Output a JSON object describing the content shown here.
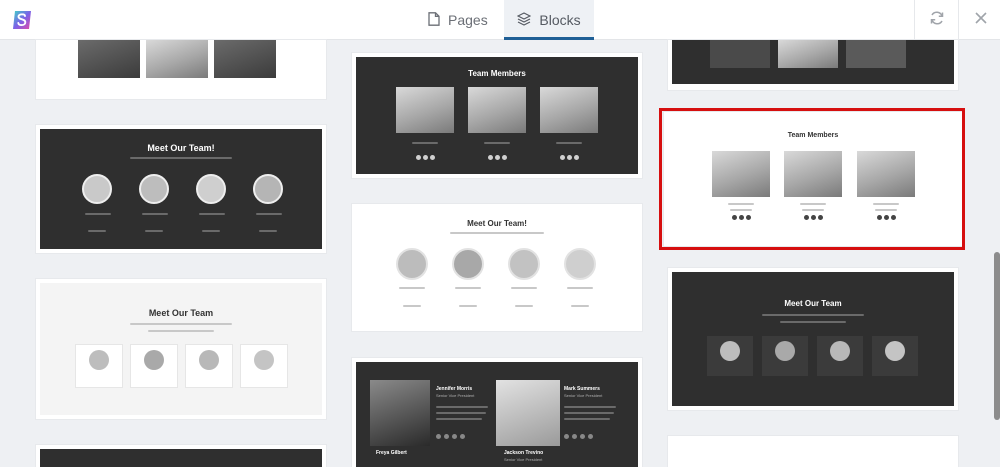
{
  "header": {
    "logo_icon": "brand-logo-icon",
    "tabs": [
      {
        "label": "Pages",
        "icon": "document-icon",
        "active": false
      },
      {
        "label": "Blocks",
        "icon": "layers-icon",
        "active": true
      }
    ],
    "refresh_icon": "refresh-icon",
    "close_icon": "close-icon"
  },
  "colors": {
    "accent": "#1f5f96",
    "selection": "#d60f0f",
    "dark_block": "#2f2f2f",
    "background": "#eef0f3"
  },
  "blocks": {
    "col1_block2": {
      "title": "Meet Our Team!"
    },
    "col1_block3": {
      "title": "Meet Our Team"
    },
    "col2_block1": {
      "title": "Team Members"
    },
    "col2_block2": {
      "title": "Meet Our Team!"
    },
    "col2_block3": {
      "members": [
        {
          "name": "Jennifer Morris",
          "role": "Senior Vice President"
        },
        {
          "name": "Mark Summers",
          "role": "Senior Vice President"
        },
        {
          "name": "Freya Gilbert",
          "role": ""
        },
        {
          "name": "Jackson Trevino",
          "role": "Senior Vice President"
        }
      ]
    },
    "col3_block2": {
      "title": "Team Members"
    },
    "col3_block3": {
      "title": "Meet Our Team"
    }
  }
}
